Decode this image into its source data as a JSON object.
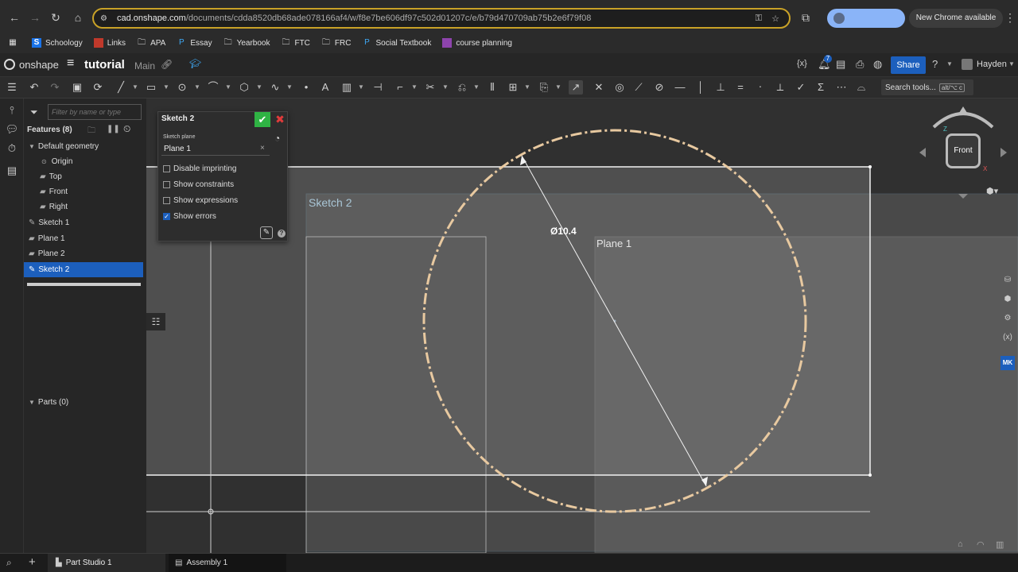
{
  "browser": {
    "url_host": "cad.onshape.com",
    "url_path": "/documents/cdda8520db68ade078166af4/w/f8e7be606df97c502d01207c/e/b79d470709ab75b2e6f79f08",
    "update_label": "New Chrome available",
    "bookmarks": [
      "Schoology",
      "Links",
      "APA",
      "Essay",
      "Yearbook",
      "FTC",
      "FRC",
      "Social Textbook",
      "course planning"
    ]
  },
  "app": {
    "brand": "onshape",
    "doc_title": "tutorial",
    "branch": "Main",
    "share_label": "Share",
    "user": "Hayden",
    "notif_count": "7",
    "search_label": "Search tools...",
    "search_shortcut": "alt/⌥ c"
  },
  "feature_panel": {
    "filter_placeholder": "Filter by name or type",
    "features_label": "Features (8)",
    "default_geometry": "Default geometry",
    "items": [
      "Origin",
      "Top",
      "Front",
      "Right",
      "Sketch 1",
      "Plane 1",
      "Plane 2",
      "Sketch 2"
    ],
    "parts_label": "Parts (0)"
  },
  "sketch_dialog": {
    "title": "Sketch 2",
    "plane_label": "Sketch plane",
    "plane_value": "Plane 1",
    "options": [
      {
        "label": "Disable imprinting",
        "checked": false
      },
      {
        "label": "Show constraints",
        "checked": false
      },
      {
        "label": "Show expressions",
        "checked": false
      },
      {
        "label": "Show errors",
        "checked": true
      }
    ]
  },
  "viewport": {
    "sketch_label": "Sketch 2",
    "plane_label": "Plane 1",
    "dimension": "Ø10.4",
    "view_cube": "Front",
    "axis_z": "Z",
    "axis_x": "X"
  },
  "tabs": [
    "Part Studio 1",
    "Assembly 1"
  ],
  "colors": {
    "circle": "#e8c9a0",
    "accent": "#1c5fbd",
    "ok": "#2fb344",
    "cancel": "#e23b3b",
    "url_border": "#c9a227"
  }
}
